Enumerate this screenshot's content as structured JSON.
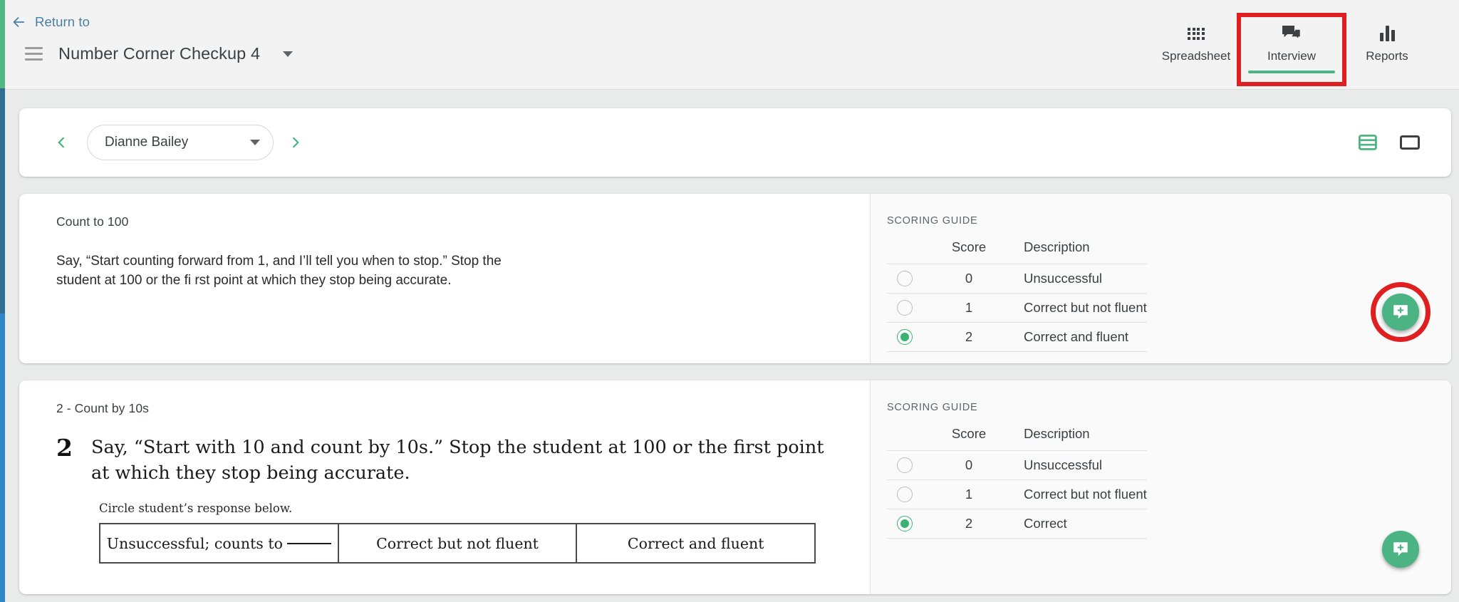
{
  "header": {
    "return_link": "Return to",
    "back_icon": "arrow-left-icon",
    "menu_icon": "hamburger-icon",
    "title": "Number Corner Checkup 4",
    "title_caret_icon": "chevron-down-icon",
    "nav": [
      {
        "label": "Spreadsheet",
        "icon": "grid-icon",
        "active": false,
        "highlighted": false
      },
      {
        "label": "Interview",
        "icon": "chat-bubbles-icon",
        "active": true,
        "highlighted": true
      },
      {
        "label": "Reports",
        "icon": "bar-chart-icon",
        "active": false,
        "highlighted": false
      }
    ]
  },
  "student_bar": {
    "prev_icon": "chevron-left-icon",
    "next_icon": "chevron-right-icon",
    "selected_student": "Dianne Bailey",
    "select_caret_icon": "chevron-down-icon",
    "view_toggles": [
      {
        "name": "list-view-icon",
        "label": "List view",
        "active": true
      },
      {
        "name": "single-card-view-icon",
        "label": "Single card view",
        "active": false
      }
    ]
  },
  "colors": {
    "accent_green": "#4cb384",
    "radio_green": "#3bb273",
    "highlight_red": "#e02020",
    "link_blue": "#4a7fa5",
    "rail_green": "#52b882",
    "rail_navy": "#2f6d94",
    "rail_blue": "#2e86c8"
  },
  "scoring_guide_title": "SCORING GUIDE",
  "scoring_columns": {
    "radio": "",
    "score": "Score",
    "description": "Description"
  },
  "cards": [
    {
      "label": "Count to 100",
      "instructions": "Say, “Start counting forward from 1, and I’ll tell you when to stop.” Stop the student at 100 or the fi rst point at which they stop being accurate.",
      "scores": [
        {
          "score": "0",
          "description": "Unsuccessful",
          "selected": false
        },
        {
          "score": "1",
          "description": "Correct but not fluent",
          "selected": false
        },
        {
          "score": "2",
          "description": "Correct and fluent",
          "selected": true
        }
      ],
      "fab": {
        "name": "add-note-button",
        "icon": "comment-plus-icon",
        "highlighted": true
      }
    },
    {
      "label": "2 - Count by 10s",
      "prompt_number": "2",
      "prompt_text": "Say, “Start with 10 and count by 10s.” Stop the student at 100 or the first point at which they stop being accurate.",
      "circle_note": "Circle student’s response below.",
      "response_options": [
        {
          "text": "Unsuccessful; counts to",
          "has_blank": true
        },
        {
          "text": "Correct but not fluent",
          "has_blank": false
        },
        {
          "text": "Correct and fluent",
          "has_blank": false
        }
      ],
      "scores": [
        {
          "score": "0",
          "description": "Unsuccessful",
          "selected": false
        },
        {
          "score": "1",
          "description": "Correct but not fluent",
          "selected": false
        },
        {
          "score": "2",
          "description": "Correct",
          "selected": true
        }
      ],
      "fab": {
        "name": "add-note-button",
        "icon": "comment-plus-icon",
        "highlighted": false
      }
    }
  ]
}
